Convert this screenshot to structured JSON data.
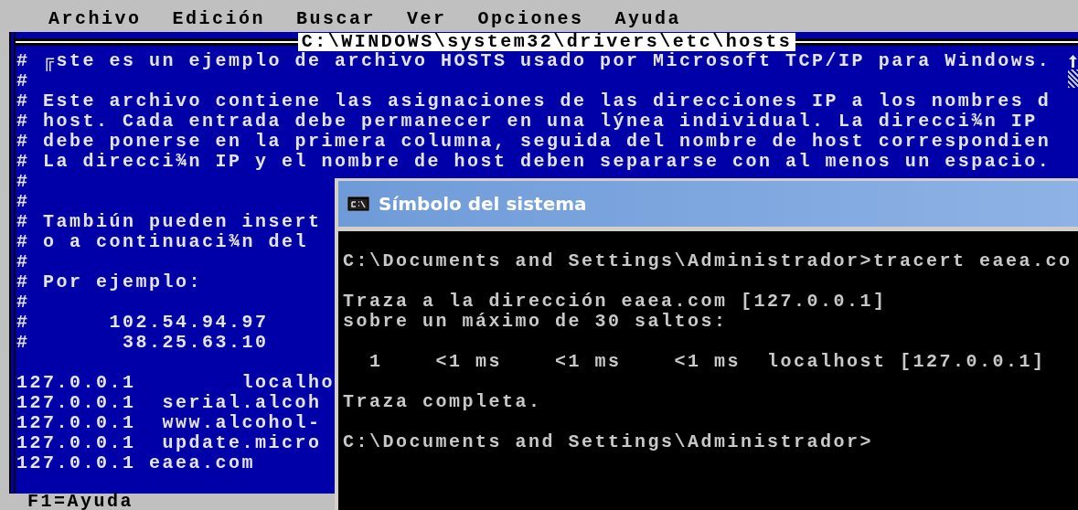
{
  "editor": {
    "menu": [
      "Archivo",
      "Edición",
      "Buscar",
      "Ver",
      "Opciones",
      "Ayuda"
    ],
    "file_title": "C:\\WINDOWS\\system32\\drivers\\etc\\hosts",
    "blocks": [
      [
        "# ╔ste es un ejemplo de archivo HOSTS usado por Microsoft TCP/IP para Windows.",
        "#",
        "# Este archivo contiene las asignaciones de las direcciones IP a los nombres d",
        "# host. Cada entrada debe permanecer en una lýnea individual. La direcci¾n IP",
        "# debe ponerse en la primera columna, seguida del nombre de host correspondien",
        "# La direcci¾n IP y el nombre de host deben separarse con al menos un espacio.",
        "#",
        "#",
        "# Tambiún pueden insert",
        "# o a continuaci¾n del",
        "#",
        "# Por ejemplo:",
        "#",
        "#      102.54.94.97",
        "#       38.25.63.10"
      ],
      [
        "127.0.0.1        localho",
        "127.0.0.1  serial.alcoh",
        "127.0.0.1  www.alcohol-",
        "127.0.0.1  update.micro",
        "127.0.0.1 eaea.com"
      ]
    ],
    "status_bar": "F1=Ayuda"
  },
  "console_window": {
    "title": "Símbolo del sistema",
    "blocks": [
      [
        "C:\\Documents and Settings\\Administrador>tracert eaea.co"
      ],
      [
        "Traza a la dirección eaea.com [127.0.0.1]",
        "sobre un máximo de 30 saltos:"
      ],
      [
        "  1    <1 ms    <1 ms    <1 ms  localhost [127.0.0.1]"
      ],
      [
        "Traza completa."
      ],
      [
        "C:\\Documents and Settings\\Administrador>"
      ]
    ]
  }
}
